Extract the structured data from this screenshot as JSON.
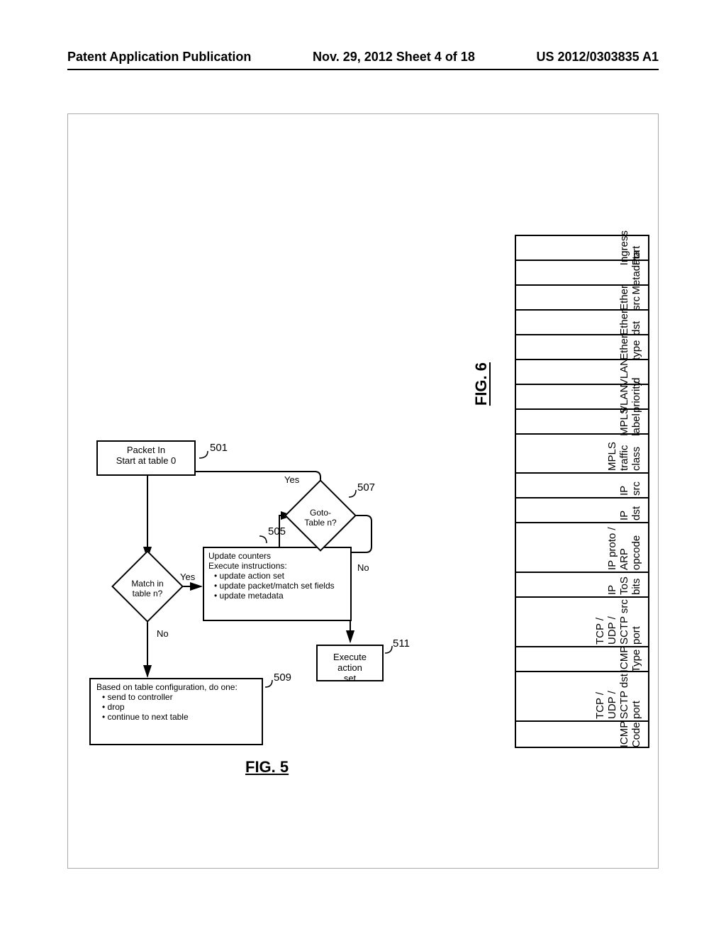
{
  "header": {
    "left": "Patent Application Publication",
    "center": "Nov. 29, 2012  Sheet 4 of 18",
    "right": "US 2012/0303835 A1"
  },
  "flow": {
    "start_l1": "Packet In",
    "start_l2": "Start at table 0",
    "n501": "501",
    "match_l1": "Match in",
    "match_l2": "table n?",
    "n503_yes": "Yes",
    "n503_no": "No",
    "update_head": "Update counters",
    "update_exec": "Execute instructions:",
    "update_b1": "update action set",
    "update_b2": "update packet/match set fields",
    "update_b3": "update metadata",
    "n505": "505",
    "n505_yes": "Yes",
    "goto_l1": "Goto-",
    "goto_l2": "Table n?",
    "n507": "507",
    "n507_no": "No",
    "exec_l1": "Execute action",
    "exec_l2": "set",
    "n511": "511",
    "based_head": "Based on table configuration, do one:",
    "based_b1": "send to controller",
    "based_b2": "drop",
    "based_b3": "continue to next table",
    "n509": "509",
    "fig5": "FIG. 5",
    "fig6": "FIG. 6"
  },
  "fields": [
    "Ingress Port",
    "Metadata",
    "Ether src",
    "Ether dst",
    "Ether type",
    "VLAN id",
    "VLAN priority",
    "MPLS label",
    "MPLS traffic class",
    "IP src",
    "IP dst",
    "IP proto / ARP opcode",
    "IP ToS bits",
    "TCP / UDP / SCTP src port",
    "ICMP Type",
    "TCP / UDP / SCTP dst port",
    "ICMP Code"
  ]
}
